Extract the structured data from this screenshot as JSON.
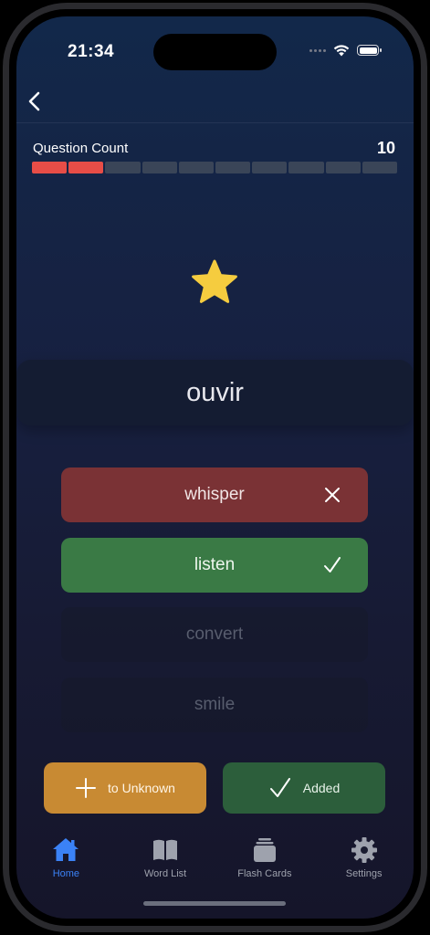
{
  "status": {
    "time": "21:34"
  },
  "quiz": {
    "question_label": "Question Count",
    "question_total": "10",
    "progress_completed": 2,
    "progress_segments": 10,
    "word": "ouvir",
    "options": [
      {
        "text": "whisper",
        "state": "wrong"
      },
      {
        "text": "listen",
        "state": "correct"
      },
      {
        "text": "convert",
        "state": "idle"
      },
      {
        "text": "smile",
        "state": "idle"
      }
    ]
  },
  "actions": {
    "to_unknown_label": "to Unknown",
    "added_label": "Added"
  },
  "tabs": [
    {
      "label": "Home",
      "icon": "house-icon",
      "active": true
    },
    {
      "label": "Word List",
      "icon": "book-icon",
      "active": false
    },
    {
      "label": "Flash Cards",
      "icon": "cards-icon",
      "active": false
    },
    {
      "label": "Settings",
      "icon": "gear-icon",
      "active": false
    }
  ],
  "colors": {
    "wrong": "#7a3235",
    "correct": "#3a7a45",
    "progress_done": "#e74d47",
    "progress_todo": "#3a4558",
    "star": "#f5cc3f",
    "tab_active": "#3b82f6",
    "unknown_button": "#c88a33",
    "added_button": "#2c5e3b"
  }
}
